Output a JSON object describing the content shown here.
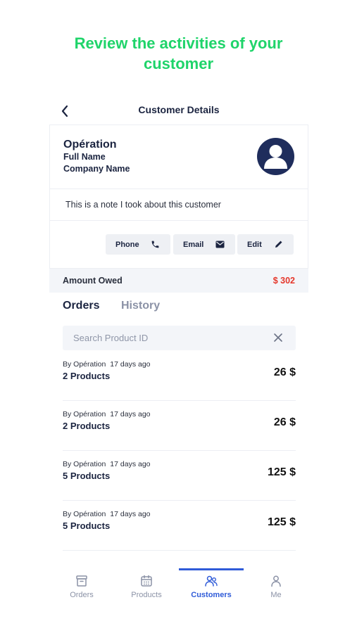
{
  "headline": {
    "line1": "Review the activities of your",
    "line2": "customer"
  },
  "nav": {
    "title": "Customer Details"
  },
  "customer": {
    "name": "Opération",
    "full_name": "Full Name",
    "company": "Company Name",
    "note": "This is a note I took about this customer"
  },
  "actions": {
    "phone": "Phone",
    "email": "Email",
    "edit": "Edit"
  },
  "amount": {
    "label": "Amount Owed",
    "value": "$ 302"
  },
  "tabs": {
    "orders": "Orders",
    "history": "History"
  },
  "search": {
    "placeholder": "Search Product ID",
    "value": ""
  },
  "orders": [
    {
      "by": "By Opération",
      "ago": "17 days ago",
      "products": "2 Products",
      "price": "26 $"
    },
    {
      "by": "By Opération",
      "ago": "17 days ago",
      "products": "2 Products",
      "price": "26 $"
    },
    {
      "by": "By Opération",
      "ago": "17 days ago",
      "products": "5 Products",
      "price": "125 $"
    },
    {
      "by": "By Opération",
      "ago": "17 days ago",
      "products": "5 Products",
      "price": "125 $"
    }
  ],
  "tabbar": {
    "items": [
      {
        "label": "Orders",
        "icon": "archive-box-icon"
      },
      {
        "label": "Products",
        "icon": "calendar-icon"
      },
      {
        "label": "Customers",
        "icon": "users-icon",
        "active": true
      },
      {
        "label": "Me",
        "icon": "user-icon"
      }
    ]
  },
  "colors": {
    "headline": "#1fd46a",
    "accent": "#2f5bd8",
    "owed": "#e5372b",
    "navy": "#1b2440"
  }
}
